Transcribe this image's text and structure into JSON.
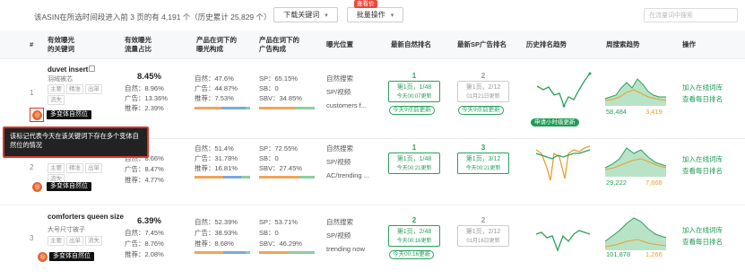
{
  "toolbar": {
    "summary": "该ASIN在所选时间段进入前 3 页的有 4,191 个（历史累计 25,829 个）",
    "download_label": "下载关键词",
    "batch_label": "批量操作",
    "batch_badge": "查看价",
    "search_placeholder": "在流量词中搜索"
  },
  "columns": {
    "index": "#",
    "keyword": [
      "有效曝光",
      "的关键词"
    ],
    "traffic": [
      "有效曝光",
      "流量占比"
    ],
    "exposure": [
      "产品在词下的",
      "曝光构成"
    ],
    "ad": [
      "产品在词下的",
      "广告构成"
    ],
    "position": "曝光位置",
    "natural_rank": "最新自然排名",
    "sp_rank": "最新SP广告排名",
    "history": "历史排名趋势",
    "weekly": "周搜索趋势",
    "action": "操作"
  },
  "rows": [
    {
      "index": "1",
      "keyword": "duvet insert",
      "translation": "羽绒被芯",
      "tags": [
        "主要",
        "精准",
        "出单",
        "流失"
      ],
      "share": "8.45%",
      "exp": [
        "自然：8.96%",
        "广告：13.36%",
        "推荐：2.39%"
      ],
      "comp": [
        "自然：47.6%",
        "广告：44.87%",
        "推荐：7.53%"
      ],
      "ads": [
        "SP：65.15%",
        "SB：0",
        "SBV：34.85%"
      ],
      "positions": [
        "自然搜索",
        "SP/视频",
        "customers f..."
      ],
      "nat_rank": "1",
      "nat_page": "第1页，1/48",
      "nat_time": "今天00:07更新",
      "nat_upd": "今天9点前更新",
      "sp_rank": "2",
      "sp_page": "第1页，2/12",
      "sp_time": "01月21日更新",
      "sp_upd": "今天9点前更新",
      "hist_badge": "申请小时级更新",
      "w_left": "58,484",
      "w_right": "3,419"
    },
    {
      "index": "2",
      "keyword": "",
      "translation": "",
      "tags": [
        "主要",
        "精准",
        "出单",
        "流失"
      ],
      "share": "",
      "exp": [
        "自然：8.66%",
        "广告：8.47%",
        "推荐：4.77%"
      ],
      "comp": [
        "自然：51.4%",
        "广告：31.78%",
        "推荐：16.81%"
      ],
      "ads": [
        "SP：72.55%",
        "SB：0",
        "SBV：27.45%"
      ],
      "positions": [
        "自然搜索",
        "SP/视频",
        "AC/trending ..."
      ],
      "nat_rank": "1",
      "nat_page": "第1页，1/48",
      "nat_time": "今天00:21更新",
      "sp_rank": "3",
      "sp_page": "第1页，3/12",
      "sp_time": "今天00:21更新",
      "w_left": "29,222",
      "w_right": "7,668"
    },
    {
      "index": "3",
      "keyword": "comforters queen size",
      "translation": "大号尺寸被子",
      "tags": [
        "主要",
        "出单",
        "流失"
      ],
      "share": "6.39%",
      "exp": [
        "自然：7.45%",
        "广告：8.76%",
        "推荐：2.08%"
      ],
      "comp": [
        "自然：52.39%",
        "广告：38.93%",
        "推荐：8.68%"
      ],
      "ads": [
        "SP：53.71%",
        "SB：0",
        "SBV：46.29%"
      ],
      "positions": [
        "自然搜索",
        "SP/视频",
        "trending now"
      ],
      "nat_rank": "2",
      "nat_page": "第1页，2/48",
      "nat_time": "今天00:16更新",
      "sp_rank": "2",
      "sp_page": "第1页，2/12",
      "sp_time": "01月16日更新",
      "w_left": "101,878",
      "w_right": "1,266"
    }
  ],
  "actions": {
    "add": "加入在线词库",
    "daily": "查看每日排名"
  },
  "multi_variant": "多变体自然位",
  "tooltip": "该标记代表今天在该关键词下存在多个变体自然位的情况",
  "colors": {
    "green": "#2aa15e",
    "orange": "#e8672f",
    "red": "#d8362b"
  }
}
